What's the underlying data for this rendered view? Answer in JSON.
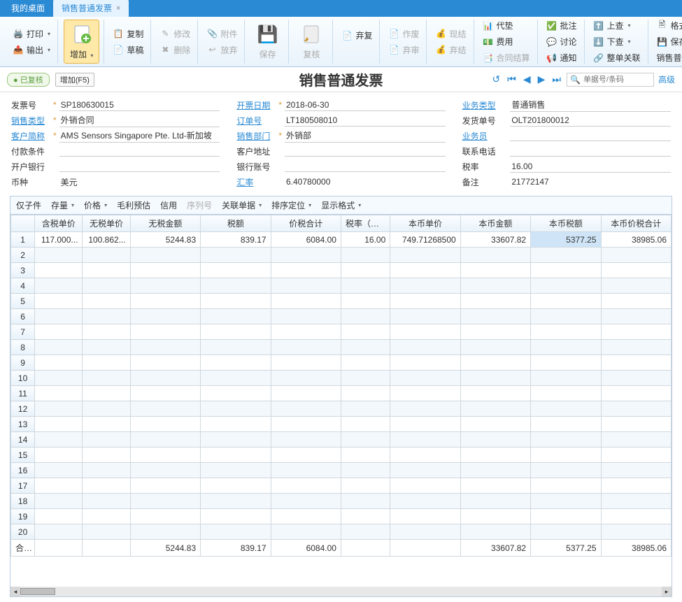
{
  "tabs": {
    "desktop": "我的桌面",
    "current": "销售普通发票"
  },
  "ribbon": {
    "print": "打印",
    "export": "输出",
    "add": "增加",
    "add_hint": "增加(F5)",
    "copy": "复制",
    "modify": "修改",
    "attach": "附件",
    "draft": "草稿",
    "delete": "删除",
    "release": "放弃",
    "save": "保存",
    "review": "复核",
    "invalid": "弃复",
    "void": "作废",
    "discard": "弃审",
    "settle": "现结",
    "close": "弃结",
    "advance": "代垫",
    "fee": "费用",
    "contract": "合同结算",
    "approve": "批注",
    "discuss": "讨论",
    "notify": "通知",
    "check_up": "上查",
    "check_down": "下查",
    "full_link": "整单关联",
    "format": "格式设置",
    "save_format": "保存格式",
    "print_format": "销售普通发票打印"
  },
  "status": {
    "reviewed": "已复核",
    "title": "销售普通发票",
    "search_ph": "单据号/条码",
    "advanced": "高级"
  },
  "fields": {
    "invoice_no": {
      "label": "发票号",
      "value": "SP180630015"
    },
    "sale_type": {
      "label": "销售类型",
      "value": "外销合同"
    },
    "customer": {
      "label": "客户简称",
      "value": "AMS Sensors Singapore Pte. Ltd-新加坡"
    },
    "pay_terms": {
      "label": "付款条件",
      "value": ""
    },
    "bank": {
      "label": "开户银行",
      "value": ""
    },
    "currency": {
      "label": "币种",
      "value": "美元"
    },
    "invoice_date": {
      "label": "开票日期",
      "value": "2018-06-30"
    },
    "order_no": {
      "label": "订单号",
      "value": "LT180508010"
    },
    "sales_dept": {
      "label": "销售部门",
      "value": "外销部"
    },
    "cust_addr": {
      "label": "客户地址",
      "value": ""
    },
    "bank_acct": {
      "label": "银行账号",
      "value": ""
    },
    "exch_rate": {
      "label": "汇率",
      "value": "6.40780000"
    },
    "biz_type": {
      "label": "业务类型",
      "value": "普通销售"
    },
    "ship_no": {
      "label": "发货单号",
      "value": "OLT201800012"
    },
    "salesman": {
      "label": "业务员",
      "value": ""
    },
    "phone": {
      "label": "联系电话",
      "value": ""
    },
    "tax_rate": {
      "label": "税率",
      "value": "16.00"
    },
    "remark": {
      "label": "备注",
      "value": "21772147"
    }
  },
  "grid_toolbar": {
    "child": "仅子件",
    "stock": "存量",
    "price": "价格",
    "profit": "毛利预估",
    "credit": "信用",
    "serial": "序列号",
    "related": "关联单据",
    "sort": "排序定位",
    "display": "显示格式"
  },
  "columns": [
    "含税单价",
    "无税单价",
    "无税金额",
    "税额",
    "价税合计",
    "税率（%）",
    "本币单价",
    "本币金额",
    "本币税额",
    "本币价税合计"
  ],
  "rows": [
    {
      "n": "1",
      "c0": "117.000...",
      "c1": "100.862...",
      "c2": "5244.83",
      "c3": "839.17",
      "c4": "6084.00",
      "c5": "16.00",
      "c6": "749.71268500",
      "c7": "33607.82",
      "c8": "5377.25",
      "c9": "38985.06"
    }
  ],
  "empty_rows": [
    "2",
    "3",
    "4",
    "5",
    "6",
    "7",
    "8",
    "9",
    "10",
    "11",
    "12",
    "13",
    "14",
    "15",
    "16",
    "17",
    "18",
    "19",
    "20"
  ],
  "totals": {
    "label": "合计",
    "c2": "5244.83",
    "c3": "839.17",
    "c4": "6084.00",
    "c7": "33607.82",
    "c8": "5377.25",
    "c9": "38985.06"
  }
}
